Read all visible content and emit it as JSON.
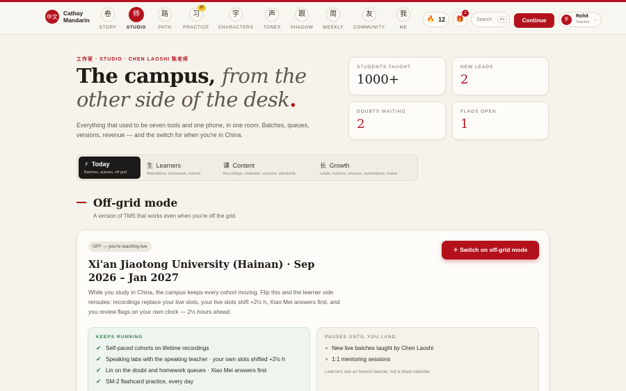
{
  "brand": {
    "logo": "中文",
    "name_line1": "Cathay",
    "name_line2": "Mandarin"
  },
  "nav": [
    {
      "glyph": "卷",
      "label": "STORY"
    },
    {
      "glyph": "师",
      "label": "STUDIO",
      "active": true
    },
    {
      "glyph": "路",
      "label": "PATH"
    },
    {
      "glyph": "习",
      "label": "PRACTICE",
      "badge": "27"
    },
    {
      "glyph": "字",
      "label": "CHARACTERS"
    },
    {
      "glyph": "声",
      "label": "TONES"
    },
    {
      "glyph": "跟",
      "label": "SHADOW"
    },
    {
      "glyph": "周",
      "label": "WEEKLY"
    },
    {
      "glyph": "友",
      "label": "COMMUNITY"
    },
    {
      "glyph": "我",
      "label": "ME"
    }
  ],
  "header": {
    "streak_icon": "fire-icon",
    "streak_glyph": "🔥",
    "streak_count": "12",
    "gift_icon": "gift-icon",
    "gift_glyph": "🎁",
    "gift_count": "2",
    "search_label": "Search",
    "search_shortcut": "⌘K",
    "continue_label": "Continue",
    "user_avatar": "罗",
    "user_name": "Rohit",
    "user_role": "Teacher",
    "user_chevron": "⌄"
  },
  "hero": {
    "eyebrow": "工作室 · STUDIO · CHEN LAOSHI 陈老师",
    "headline_bold": "The campus,",
    "headline_italic": "from the other side of the desk",
    "headline_dot": ".",
    "lede": "Everything that used to be seven tools and one phone, in one room. Batches, queues, versions, revenue — and the switch for when you're in China."
  },
  "stats": [
    {
      "label": "STUDENTS TAUGHT",
      "value": "1000+",
      "red": false
    },
    {
      "label": "NEW LEADS",
      "value": "2",
      "red": true
    },
    {
      "label": "DOUBTS WAITING",
      "value": "2",
      "red": true
    },
    {
      "label": "FLAGS OPEN",
      "value": "1",
      "red": true
    }
  ],
  "tabs": [
    {
      "glyph": "⚡",
      "title": "Today",
      "sub": "Batches, queues, off-grid",
      "active": true
    },
    {
      "glyph": "生",
      "title": "Learners",
      "sub": "Attendance, homework, cohorts"
    },
    {
      "glyph": "课",
      "title": "Content",
      "sub": "Recordings, materials, versions, standards"
    },
    {
      "glyph": "长",
      "title": "Growth",
      "sub": "Leads, batches, revenue, automations, teams"
    }
  ],
  "section": {
    "title": "Off-grid mode",
    "subtitle": "A version of TMS that works even when you're off the grid."
  },
  "card": {
    "status_chip": "OFF — you're teaching live",
    "switch_label": "✈ Switch on off-grid mode",
    "title": "Xi'an Jiaotong University (Hainan) · Sep 2026 – Jan 2027",
    "description": "While you study in China, the campus keeps every cohort moving. Flip this and the learner side reroutes: recordings replace your live slots, your live slots shift +2½ h, Xiao Mei answers first, and you review flags on your own clock — 2½ hours ahead.",
    "keeps": {
      "label": "KEEPS RUNNING",
      "items": [
        "Self-paced cohorts on lifetime recordings",
        "Speaking labs with the speaking teacher · your own slots shifted +2½ h",
        "Lin on the doubt and homework queues · Xiao Mei answers first",
        "SM-2 flashcard practice, every day"
      ]
    },
    "pauses": {
      "label": "PAUSES UNTIL YOU LAND",
      "items": [
        "New live batches taught by Chen Laoshi",
        "1:1 mentoring sessions"
      ],
      "note": "Learners see an honest banner, not a dead calendar."
    }
  },
  "colors": {
    "accent": "#b3121d",
    "background": "#f6f3ec",
    "success": "#2e7a48"
  }
}
